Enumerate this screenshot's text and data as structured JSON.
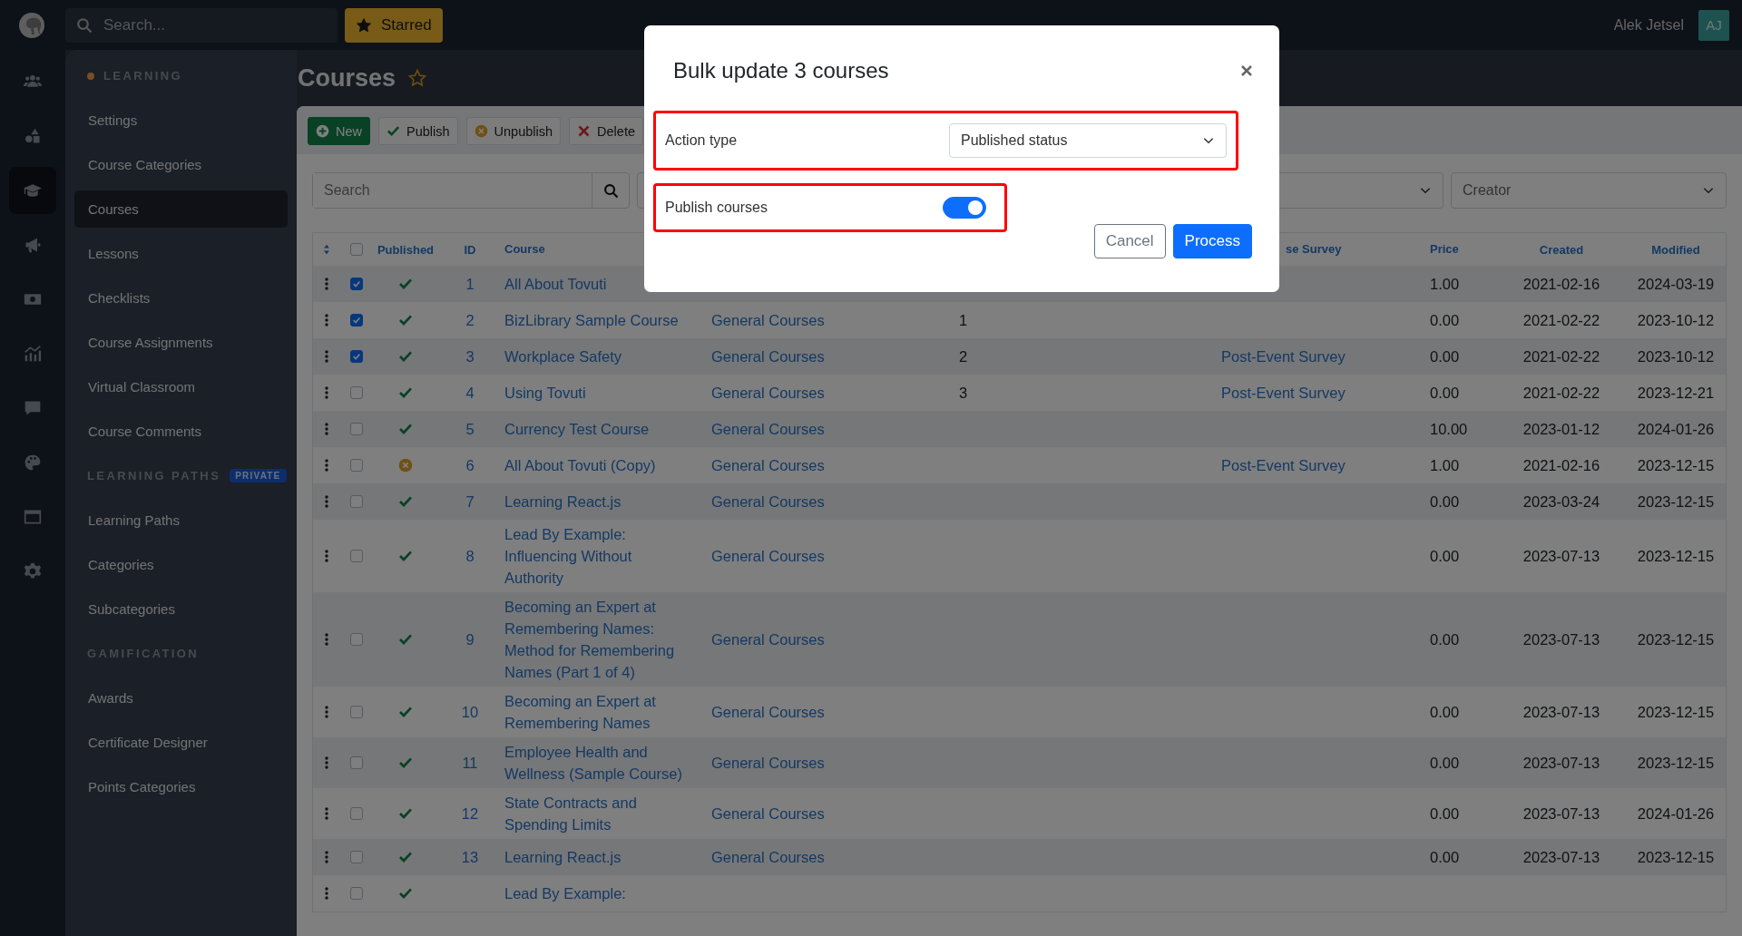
{
  "topbar": {
    "search_placeholder": "Search...",
    "starred_label": "Starred",
    "user_name": "Alek Jetsel",
    "avatar_initials": "AJ"
  },
  "rail": [
    {
      "kind": "people",
      "selected": false
    },
    {
      "kind": "shapes",
      "selected": false
    },
    {
      "kind": "graduation-cap",
      "selected": true
    },
    {
      "kind": "megaphone",
      "selected": false
    },
    {
      "kind": "money",
      "selected": false
    },
    {
      "kind": "chart",
      "selected": false
    },
    {
      "kind": "chat",
      "selected": false
    },
    {
      "kind": "palette",
      "selected": false
    },
    {
      "kind": "window",
      "selected": false
    },
    {
      "kind": "gear",
      "selected": false
    }
  ],
  "sidebar": {
    "sections": [
      {
        "title": "LEARNING",
        "dot": true,
        "items": [
          {
            "label": "Settings",
            "selected": false
          },
          {
            "label": "Course Categories",
            "selected": false
          },
          {
            "label": "Courses",
            "selected": true
          },
          {
            "label": "Lessons",
            "selected": false
          },
          {
            "label": "Checklists",
            "selected": false
          },
          {
            "label": "Course Assignments",
            "selected": false
          },
          {
            "label": "Virtual Classroom",
            "selected": false
          },
          {
            "label": "Course Comments",
            "selected": false
          }
        ]
      },
      {
        "title": "LEARNING PATHS",
        "badge": "PRIVATE",
        "items": [
          {
            "label": "Learning Paths",
            "selected": false
          },
          {
            "label": "Categories",
            "selected": false
          },
          {
            "label": "Subcategories",
            "selected": false
          }
        ]
      },
      {
        "title": "GAMIFICATION",
        "items": [
          {
            "label": "Awards",
            "selected": false
          },
          {
            "label": "Certificate Designer",
            "selected": false
          },
          {
            "label": "Points Categories",
            "selected": false
          }
        ]
      }
    ]
  },
  "page": {
    "title": "Courses",
    "starred": false
  },
  "toolbar": [
    {
      "kind": "new",
      "label": "New"
    },
    {
      "kind": "publish",
      "label": "Publish"
    },
    {
      "kind": "unpublish",
      "label": "Unpublish"
    },
    {
      "kind": "delete",
      "label": "Delete"
    }
  ],
  "filters": {
    "search_placeholder": "Search",
    "selects": [
      {
        "kind": "select"
      },
      {
        "kind": "select",
        "placeholder": "Creator"
      }
    ]
  },
  "table": {
    "select_all_checked": false,
    "columns": {
      "published": "Published",
      "id": "ID",
      "course": "Course",
      "survey": "se Survey",
      "price": "Price",
      "created": "Created",
      "modified": "Modified"
    },
    "rows": [
      {
        "selected": true,
        "published": true,
        "id": "1",
        "course": "All About Tovuti",
        "price": "1.00",
        "created": "2021-02-16",
        "modified": "2024-03-19"
      },
      {
        "selected": true,
        "published": true,
        "id": "2",
        "course": "BizLibrary Sample Course",
        "column_5": "General Courses",
        "column_6": "1",
        "price": "0.00",
        "created": "2021-02-22",
        "modified": "2023-10-12"
      },
      {
        "selected": true,
        "published": true,
        "id": "3",
        "course": "Workplace Safety",
        "column_5": "General Courses",
        "column_6": "2",
        "survey": "Post-Event Survey",
        "price": "0.00",
        "created": "2021-02-22",
        "modified": "2023-10-12"
      },
      {
        "selected": false,
        "published": true,
        "id": "4",
        "course": "Using Tovuti",
        "column_5": "General Courses",
        "column_6": "3",
        "survey": "Post-Event Survey",
        "price": "0.00",
        "created": "2021-02-22",
        "modified": "2023-12-21"
      },
      {
        "selected": false,
        "published": true,
        "id": "5",
        "course": "Currency Test Course",
        "column_5": "General Courses",
        "price": "10.00",
        "created": "2023-01-12",
        "modified": "2024-01-26"
      },
      {
        "selected": false,
        "published": false,
        "id": "6",
        "course": "All About Tovuti (Copy)",
        "column_5": "General Courses",
        "survey": "Post-Event Survey",
        "price": "1.00",
        "created": "2021-02-16",
        "modified": "2023-12-15"
      },
      {
        "selected": false,
        "published": true,
        "id": "7",
        "course": "Learning React.js",
        "column_5": "General Courses",
        "price": "0.00",
        "created": "2023-03-24",
        "modified": "2023-12-15"
      },
      {
        "selected": false,
        "published": true,
        "id": "8",
        "course": "Lead By Example: Influencing Without Authority",
        "column_5": "General Courses",
        "price": "0.00",
        "created": "2023-07-13",
        "modified": "2023-12-15"
      },
      {
        "selected": false,
        "published": true,
        "id": "9",
        "course": "Becoming an Expert at Remembering Names: Method for Remembering Names (Part 1 of 4)",
        "column_5": "General Courses",
        "price": "0.00",
        "created": "2023-07-13",
        "modified": "2023-12-15"
      },
      {
        "selected": false,
        "published": true,
        "id": "10",
        "course": "Becoming an Expert at Remembering Names",
        "column_5": "General Courses",
        "price": "0.00",
        "created": "2023-07-13",
        "modified": "2023-12-15"
      },
      {
        "selected": false,
        "published": true,
        "id": "11",
        "course": "Employee Health and Wellness (Sample Course)",
        "column_5": "General Courses",
        "price": "0.00",
        "created": "2023-07-13",
        "modified": "2023-12-15"
      },
      {
        "selected": false,
        "published": true,
        "id": "12",
        "course": "State Contracts and Spending Limits",
        "column_5": "General Courses",
        "price": "0.00",
        "created": "2023-07-13",
        "modified": "2024-01-26"
      },
      {
        "selected": false,
        "published": true,
        "id": "13",
        "course": "Learning React.js",
        "column_5": "General Courses",
        "price": "0.00",
        "created": "2023-07-13",
        "modified": "2023-12-15"
      },
      {
        "selected": false,
        "published": true,
        "course": "Lead By Example:"
      }
    ]
  },
  "modal": {
    "title": "Bulk update 3 courses",
    "fields": [
      {
        "kind": "select",
        "label": "Action type",
        "value": "Published status",
        "highlighted": true
      },
      {
        "kind": "toggle",
        "label": "Publish courses",
        "on": true,
        "highlighted": true
      }
    ],
    "cancel_label": "Cancel",
    "process_label": "Process"
  }
}
